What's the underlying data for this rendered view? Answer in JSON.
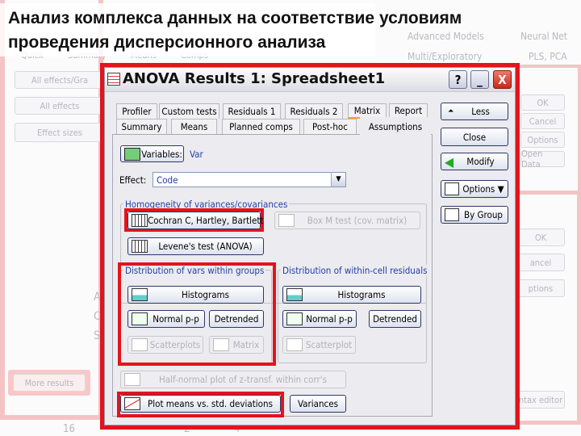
{
  "slide_title": {
    "line1": "Анализ комплекса данных на соответствие условиям",
    "line2": "проведения дисперсионного анализа"
  },
  "background": {
    "left_tabs": [
      "Quick",
      "Summary",
      "Means",
      "Comps"
    ],
    "left_buttons": [
      "All effects/Gra",
      "All effects",
      "Effect sizes"
    ],
    "more_results": "More results",
    "left_letters": [
      "A",
      "C",
      "S"
    ],
    "top_right": [
      "Advanced Models",
      "Neural Net",
      "Multi/Exploratory",
      "PLS, PCA"
    ],
    "right_buttons": [
      "OK",
      "Cancel",
      "Options",
      "Open Data"
    ],
    "right_buttons2": [
      "OK",
      "ancel",
      "ptions",
      "ntax editor"
    ],
    "grid_numbers": [
      "16",
      "2",
      "4"
    ]
  },
  "dialog": {
    "title": "ANOVA Results 1: Spreadsheet1",
    "title_buttons": [
      "?",
      "_",
      "X"
    ],
    "tabs_row1": [
      "Profiler",
      "Custom tests",
      "Residuals 1",
      "Residuals 2",
      "Matrix",
      "Report"
    ],
    "tabs_row2": [
      "Summary",
      "Means",
      "Planned comps",
      "Post-hoc",
      "Assumptions"
    ],
    "active_tab": "Assumptions",
    "variables_label": "Variables:",
    "variables_value": "Var",
    "effect_label": "Effect:",
    "effect_value": "Code",
    "homogeneity": {
      "label": "Homogeneity of variances/covariances",
      "cochran": "Cochran C, Hartley, Bartlett",
      "boxm": "Box M test (cov. matrix)",
      "levene": "Levene's test (ANOVA)"
    },
    "dist_groups": {
      "label": "Distribution of vars within groups",
      "histograms": "Histograms",
      "normal": "Normal p-p",
      "detrended": "Detrended",
      "scatterplots": "Scatterplots",
      "matrix": "Matrix"
    },
    "dist_resid": {
      "label": "Distribution of within-cell residuals",
      "histograms": "Histograms",
      "normal": "Normal p-p",
      "detrended": "Detrended",
      "scatterplot": "Scatterplot"
    },
    "half_normal": "Half-normal plot of z-transf. within corr's",
    "plot_means": "Plot means vs. std. deviations",
    "variances": "Variances",
    "side_buttons": {
      "less": "Less",
      "close": "Close",
      "modify": "Modify",
      "options": "Options ▼",
      "by_group": "By Group"
    },
    "highlight_color": "#e2141c"
  }
}
